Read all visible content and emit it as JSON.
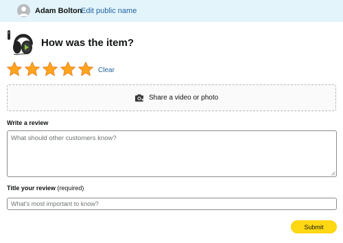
{
  "header": {
    "user_name": "Adam Bolton",
    "edit_label": "Edit public name",
    "background": "#e3f4fb"
  },
  "product": {
    "image_icon": "gaming-headset-image",
    "question": "How was the item?"
  },
  "rating": {
    "selected": 5,
    "max": 5,
    "star_color": "#ffa41c",
    "clear_label": "Clear"
  },
  "media": {
    "icon": "camera-plus-icon",
    "label": "Share a video or photo"
  },
  "review": {
    "label": "Write a review",
    "placeholder": "What should other customers know?",
    "value": ""
  },
  "title": {
    "label": "Title your review",
    "required_note": "(required)",
    "placeholder": "What's most important to know?",
    "value": ""
  },
  "submit": {
    "label": "Submit",
    "color": "#ffd814"
  },
  "colors": {
    "link": "#2162a1"
  }
}
